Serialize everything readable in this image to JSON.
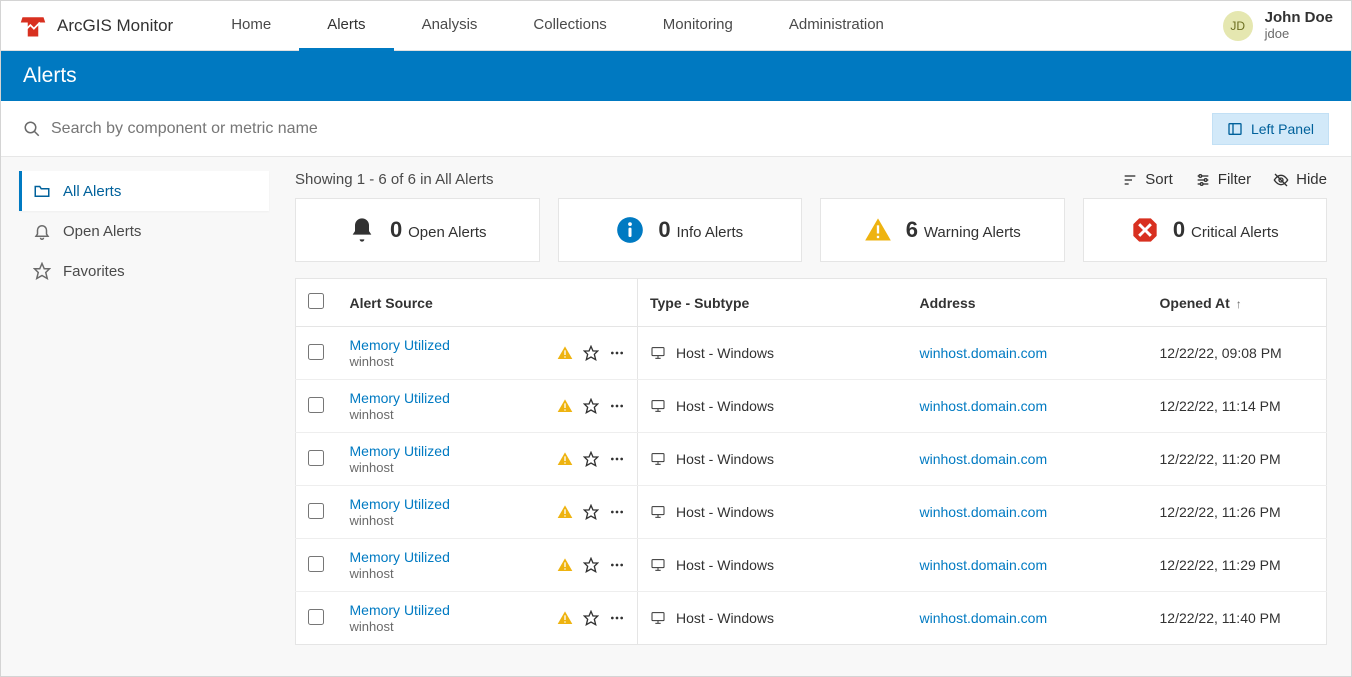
{
  "brand": {
    "name": "ArcGIS Monitor"
  },
  "nav": {
    "items": [
      {
        "label": "Home"
      },
      {
        "label": "Alerts"
      },
      {
        "label": "Analysis"
      },
      {
        "label": "Collections"
      },
      {
        "label": "Monitoring"
      },
      {
        "label": "Administration"
      }
    ],
    "active_index": 1
  },
  "user": {
    "initials": "JD",
    "name": "John Doe",
    "login": "jdoe"
  },
  "page_title": "Alerts",
  "search": {
    "placeholder": "Search by component or metric name"
  },
  "left_panel_btn": "Left Panel",
  "sidebar": {
    "items": [
      {
        "label": "All Alerts",
        "icon": "folder"
      },
      {
        "label": "Open Alerts",
        "icon": "bell"
      },
      {
        "label": "Favorites",
        "icon": "star"
      }
    ],
    "active_index": 0
  },
  "showing": "Showing 1 - 6 of 6 in All Alerts",
  "toolbar": {
    "sort": "Sort",
    "filter": "Filter",
    "hide": "Hide"
  },
  "summary": {
    "open": {
      "count": "0",
      "label": "Open Alerts"
    },
    "info": {
      "count": "0",
      "label": "Info Alerts"
    },
    "warning": {
      "count": "6",
      "label": "Warning Alerts"
    },
    "critical": {
      "count": "0",
      "label": "Critical Alerts"
    }
  },
  "table": {
    "headers": {
      "source": "Alert Source",
      "type": "Type - Subtype",
      "address": "Address",
      "opened": "Opened At"
    },
    "rows": [
      {
        "source": "Memory Utilized",
        "host": "winhost",
        "type": "Host - Windows",
        "address": "winhost.domain.com",
        "opened": "12/22/22, 09:08 PM"
      },
      {
        "source": "Memory Utilized",
        "host": "winhost",
        "type": "Host - Windows",
        "address": "winhost.domain.com",
        "opened": "12/22/22, 11:14 PM"
      },
      {
        "source": "Memory Utilized",
        "host": "winhost",
        "type": "Host - Windows",
        "address": "winhost.domain.com",
        "opened": "12/22/22, 11:20 PM"
      },
      {
        "source": "Memory Utilized",
        "host": "winhost",
        "type": "Host - Windows",
        "address": "winhost.domain.com",
        "opened": "12/22/22, 11:26 PM"
      },
      {
        "source": "Memory Utilized",
        "host": "winhost",
        "type": "Host - Windows",
        "address": "winhost.domain.com",
        "opened": "12/22/22, 11:29 PM"
      },
      {
        "source": "Memory Utilized",
        "host": "winhost",
        "type": "Host - Windows",
        "address": "winhost.domain.com",
        "opened": "12/22/22, 11:40 PM"
      }
    ]
  },
  "colors": {
    "primary": "#007ac2",
    "warn": "#eeb310",
    "info": "#007ac2",
    "critical": "#d83020"
  }
}
